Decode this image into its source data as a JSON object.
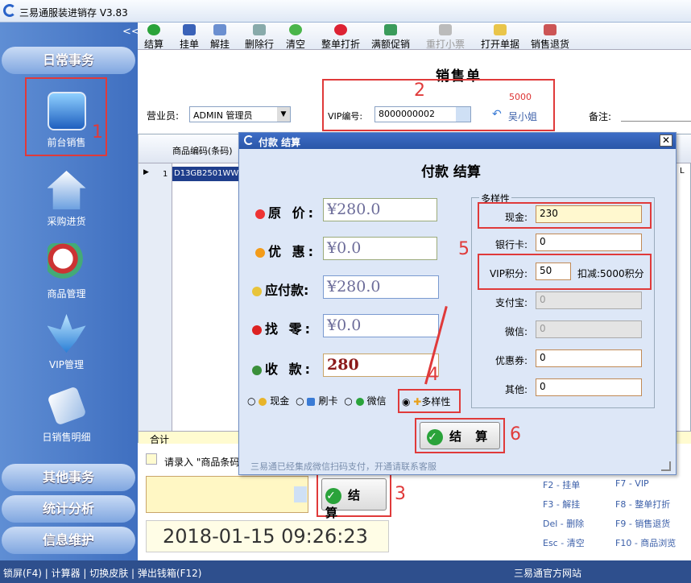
{
  "app": {
    "title": "三易通服装进销存 V3.83"
  },
  "sidebar": {
    "collapse": "<<",
    "top_section": "日常事务",
    "items": [
      {
        "label": "前台销售"
      },
      {
        "label": "采购进货"
      },
      {
        "label": "商品管理"
      },
      {
        "label": "VIP管理"
      },
      {
        "label": "日销售明细"
      }
    ],
    "bottom_sections": [
      "其他事务",
      "统计分析",
      "信息维护"
    ]
  },
  "toolbar": [
    "结算",
    "挂单",
    "解挂",
    "删除行",
    "清空",
    "整单打折",
    "满额促销",
    "重打小票",
    "打开单据",
    "销售退货"
  ],
  "main": {
    "title": "销售单",
    "staff_label": "营业员:",
    "staff_value": "ADMIN 管理员",
    "vip_label": "VIP编号:",
    "vip_value": "8000000002",
    "vip_points": "5000",
    "vip_name": "吴小姐",
    "note_label": "备注:",
    "grid_header": "商品编码(条码)",
    "row_no": "1",
    "row_code": "D13GB2501WWL",
    "total_label": "合计",
    "hint": "请录入 \"商品条码",
    "settle_label": "结 算",
    "datetime": "2018-01-15 09:26:23",
    "hotkeys": [
      [
        "F2 - 挂单",
        "F7 - VIP"
      ],
      [
        "F3 - 解挂",
        "F8 - 整单打折"
      ],
      [
        "Del - 删除",
        "F9 - 销售退货"
      ],
      [
        "Esc - 清空",
        "F10 - 商品浏览"
      ]
    ]
  },
  "dialog": {
    "title": "付款 结算",
    "heading": "付款 结算",
    "fields": [
      {
        "label": "原 价:",
        "value": "¥280.0"
      },
      {
        "label": "优 惠:",
        "value": "¥0.0"
      },
      {
        "label": "应付款:",
        "value": "¥280.0"
      },
      {
        "label": "找 零:",
        "value": "¥0.0"
      },
      {
        "label": "收 款:",
        "value": "280"
      }
    ],
    "methods": [
      "现金",
      "刷卡",
      "微信",
      "多样性"
    ],
    "group_title": "多样性",
    "right": [
      {
        "label": "现金:",
        "value": "230"
      },
      {
        "label": "银行卡:",
        "value": "0"
      },
      {
        "label": "VIP积分:",
        "value": "50"
      },
      {
        "label": "支付宝:",
        "value": "0"
      },
      {
        "label": "微信:",
        "value": "0"
      },
      {
        "label": "优惠券:",
        "value": "0"
      },
      {
        "label": "其他:",
        "value": "0"
      }
    ],
    "deduct": "扣减:5000积分",
    "settle_label": "结 算",
    "footer": "三易通已经集成微信扫码支付，开通请联系客服"
  },
  "annotations": [
    "1",
    "2",
    "3",
    "4",
    "5",
    "6"
  ],
  "status": {
    "left": "锁屏(F4) | 计算器 | 切换皮肤 | 弹出钱箱(F12)",
    "right": "三易通官方网站"
  }
}
